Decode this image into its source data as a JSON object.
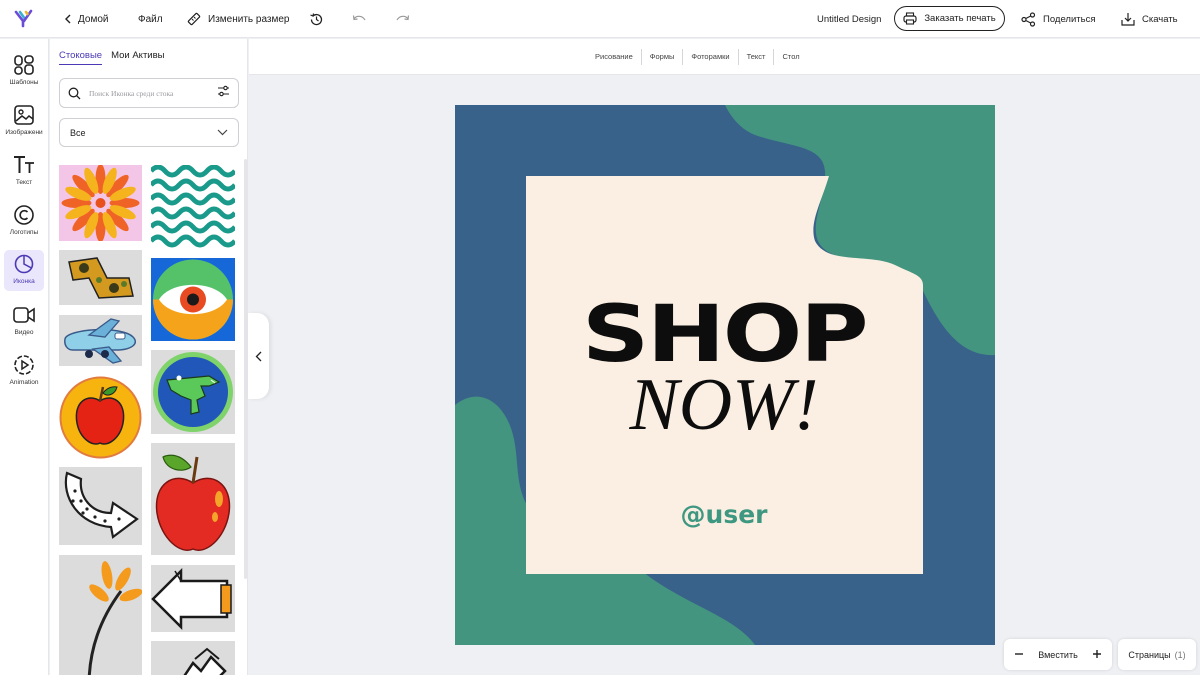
{
  "topbar": {
    "home_label": "Домой",
    "file_label": "Файл",
    "resize_label": "Изменить размер",
    "document_title": "Untitled Design",
    "print_label": "Заказать печать",
    "share_label": "Поделиться",
    "download_label": "Скачать"
  },
  "rail": {
    "items": [
      {
        "label": "Шаблоны",
        "icon": "templates-icon"
      },
      {
        "label": "Изображени",
        "icon": "image-icon"
      },
      {
        "label": "Текст",
        "icon": "text-icon"
      },
      {
        "label": "Логотипы",
        "icon": "logo-icon"
      },
      {
        "label": "Иконка",
        "icon": "icon-shape-icon",
        "active": true
      },
      {
        "label": "Видео",
        "icon": "video-icon"
      },
      {
        "label": "Animation",
        "icon": "animation-icon"
      }
    ]
  },
  "panel": {
    "tabs": [
      {
        "label": "Стоковые",
        "active": true
      },
      {
        "label": "Мои Активы",
        "active": false
      }
    ],
    "search_placeholder": "Поиск Иконка среди стока",
    "filter_value": "Все",
    "thumbnails": [
      "flower-burst",
      "teal-wave-pattern",
      "camo-arrow",
      "eye-circle",
      "toy-airplane",
      "crocodile-badge",
      "apple-badge",
      "red-apple",
      "dotted-arrow",
      "orange-flower-stem",
      "outline-arrow-left",
      "outline-arrow-up"
    ]
  },
  "subbar": {
    "tabs": [
      "Рисование",
      "Формы",
      "Фоторамки",
      "Текст",
      "Стол"
    ]
  },
  "canvas": {
    "headline": "SHOP",
    "subheadline": "NOW!",
    "handle": "@user",
    "colors": {
      "navy": "#38628a",
      "teal": "#43957f",
      "cream": "#faefe2",
      "text": "#0d0d0d",
      "handle": "#3e9780"
    }
  },
  "bottom": {
    "fit_label": "Вместить",
    "pages_label": "Страницы",
    "pages_count": "(1)"
  }
}
